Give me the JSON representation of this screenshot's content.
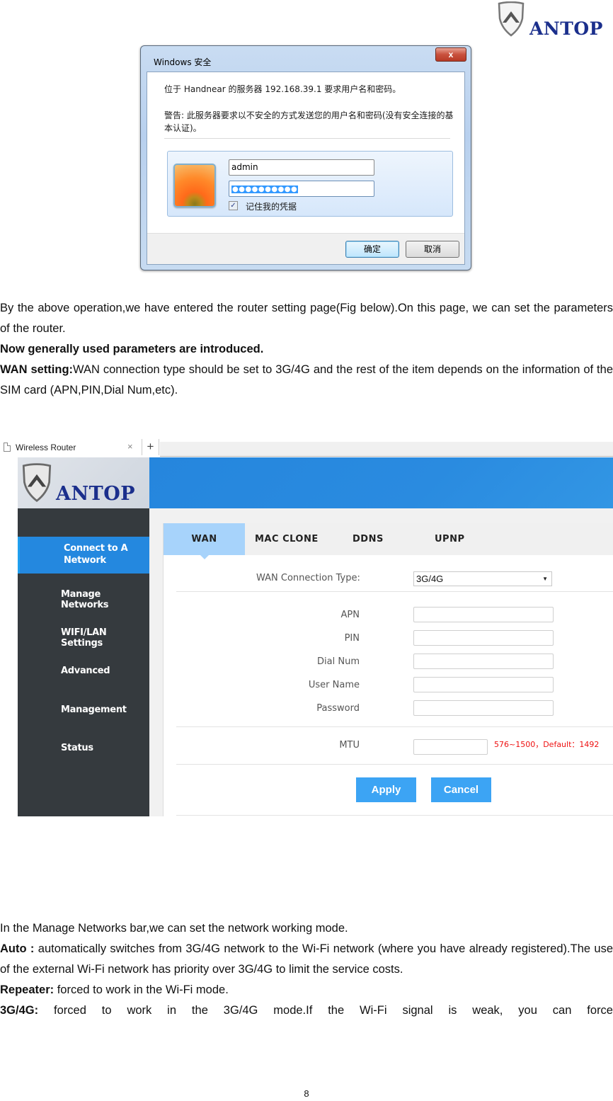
{
  "header": {
    "brand": "ANTOP"
  },
  "login_dialog": {
    "title": "Windows 安全",
    "close_label": "x",
    "message": "位于 Handnear 的服务器 192.168.39.1 要求用户名和密码。",
    "warning": "警告: 此服务器要求以不安全的方式发送您的用户名和密码(没有安全连接的基本认证)。",
    "username_value": "admin",
    "password_mask": "●●●●●●●●●●",
    "remember_checked": "✓",
    "remember_label": "记住我的凭据",
    "ok_label": "确定",
    "cancel_label": "取消"
  },
  "text_block_1": {
    "p1": "By the above operation,we have entered the router setting page(Fig below).On this page, we can set the parameters of the router.",
    "p2": "Now generally used parameters are introduced.",
    "p3_bold": "WAN setting:",
    "p3": "WAN connection type should be set to 3G/4G and the rest of the item depends on the information of the SIM card (APN,PIN,Dial Num,etc)."
  },
  "browser": {
    "tab_title": "Wireless Router",
    "tab_close": "×",
    "new_tab": "+"
  },
  "router": {
    "brand": "ANTOP",
    "sidebar": [
      {
        "label": "Connect to A Network",
        "active": true
      },
      {
        "label": "Manage Networks"
      },
      {
        "label": "WIFI/LAN Settings"
      },
      {
        "label": "Advanced"
      },
      {
        "label": "Management"
      },
      {
        "label": "Status"
      }
    ],
    "tabs": [
      {
        "label": "WAN",
        "active": true
      },
      {
        "label": "MAC CLONE"
      },
      {
        "label": "DDNS"
      },
      {
        "label": "UPNP"
      }
    ],
    "wan_type_label": "WAN Connection Type:",
    "wan_type_value": "3G/4G",
    "fields": [
      {
        "label": "APN",
        "value": ""
      },
      {
        "label": "PIN",
        "value": ""
      },
      {
        "label": "Dial Num",
        "value": ""
      },
      {
        "label": "User Name",
        "value": ""
      },
      {
        "label": "Password",
        "value": ""
      }
    ],
    "mtu_label": "MTU",
    "mtu_value": "",
    "mtu_hint": "576~1500，Default：1492",
    "apply_label": "Apply",
    "cancel_label": "Cancel"
  },
  "text_block_2": {
    "p1": "In the Manage Networks bar,we can set the network working mode.",
    "auto_bold": "Auto :",
    "auto": " automatically switches from 3G/4G network to the Wi-Fi network (where you have already registered).The use of the external Wi-Fi network has priority over 3G/4G to limit the service costs.",
    "repeater_bold": "Repeater:",
    "repeater": " forced to work in the Wi-Fi mode.",
    "g_bold": "3G/4G:",
    "g": " forced to work in the 3G/4G mode.If the Wi-Fi signal is weak, you can force"
  },
  "footer": {
    "page_number": "8"
  }
}
